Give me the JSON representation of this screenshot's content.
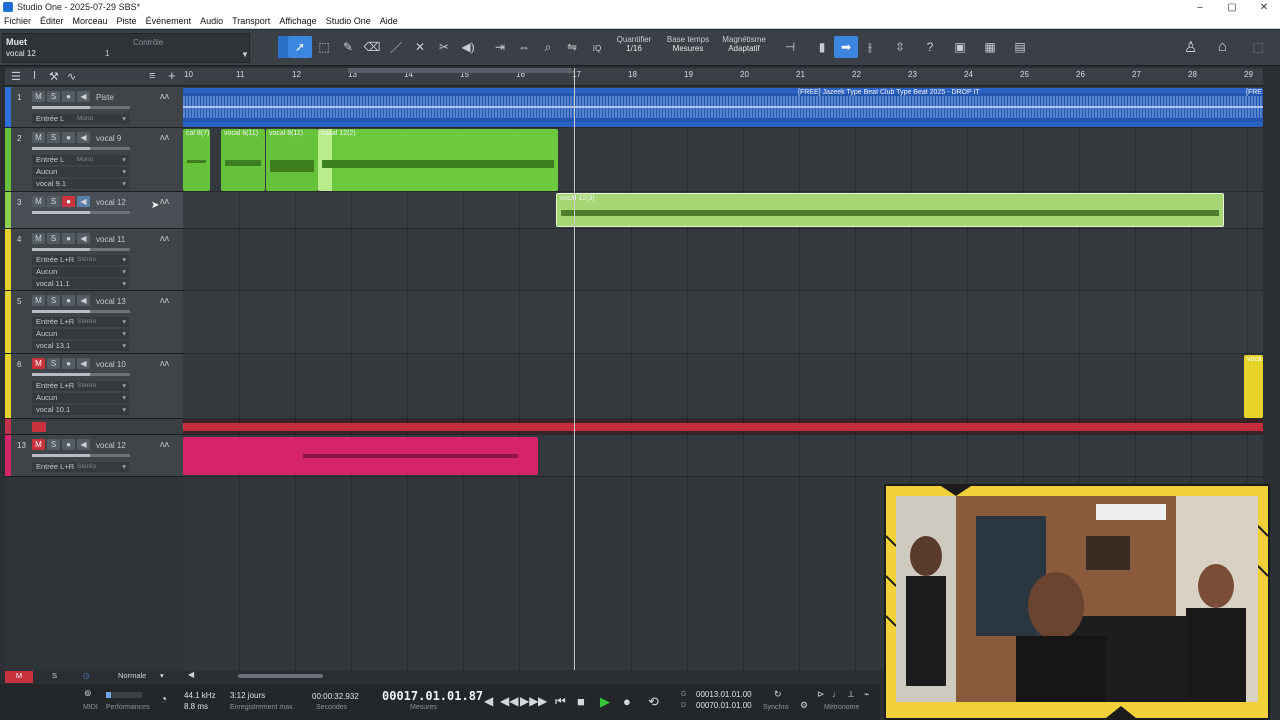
{
  "window": {
    "title": "Studio One - 2025-07-29 SBS*",
    "controls": [
      "–",
      "▢",
      "✕"
    ]
  },
  "menu": [
    "Fichier",
    "Éditer",
    "Morceau",
    "Piste",
    "Événement",
    "Audio",
    "Transport",
    "Affichage",
    "Studio One",
    "Aide"
  ],
  "inspector": {
    "mode": "Muet",
    "controle_label": "Contrôle",
    "track_name": "vocal 12",
    "value": "1"
  },
  "toolbar": {
    "quantize_label": "Quantifier",
    "quantize_value": "1/16",
    "timebase_label": "Base temps",
    "timebase_value": "Mesures",
    "snap_label": "Magnétisme",
    "snap_value": "Adaptatif",
    "iq_label": "IQ"
  },
  "ruler": {
    "bars": [
      "10",
      "11",
      "12",
      "13",
      "14",
      "15",
      "16",
      "17",
      "18",
      "19",
      "20",
      "21",
      "22",
      "23",
      "24",
      "25",
      "26",
      "27",
      "28",
      "29"
    ]
  },
  "tracks": [
    {
      "num": "1",
      "name": "Piste",
      "input": "Entrée L",
      "input_tag": "Mono",
      "color": "#2f6fd8",
      "mute": false,
      "rec": false,
      "rows": []
    },
    {
      "num": "2",
      "name": "vocal 9",
      "input": "Entrée L",
      "input_tag": "Mono",
      "color": "#66c23a",
      "mute": false,
      "rec": false,
      "rows": [
        "Aucun",
        "vocal 9.1"
      ]
    },
    {
      "num": "3",
      "name": "vocal 12",
      "input": "",
      "input_tag": "",
      "color": "#8ed04b",
      "mute": false,
      "rec": true,
      "rows": []
    },
    {
      "num": "4",
      "name": "vocal 11",
      "input": "Entrée L+R",
      "input_tag": "Stéréo",
      "color": "#e6d32a",
      "mute": false,
      "rec": false,
      "rows": [
        "Aucun",
        "vocal 11.1"
      ]
    },
    {
      "num": "5",
      "name": "vocal 13",
      "input": "Entrée L+R",
      "input_tag": "Stéréo",
      "color": "#e6d32a",
      "mute": false,
      "rec": false,
      "rows": [
        "Aucun",
        "vocal 13.1"
      ]
    },
    {
      "num": "6",
      "name": "vocal 10",
      "input": "Entrée L+R",
      "input_tag": "Stéréo",
      "color": "#e6d32a",
      "mute": true,
      "rec": false,
      "rows": [
        "Aucun",
        "vocal 10.1"
      ]
    },
    {
      "num": "13",
      "name": "vocal 12",
      "input": "Entrée L+R",
      "input_tag": "Stéréo",
      "color": "#d6246b",
      "mute": true,
      "rec": false,
      "rows": []
    }
  ],
  "events": {
    "beat_title": "[FREE] Jazeek Type Beat  Club Type Beat 2025 - DROP IT",
    "beat_title_2": "[FRE",
    "vocal9_labels": [
      "cal 8(7)",
      "vocal 8(11)",
      "vocal 8(11)",
      "vocal 12(2)"
    ],
    "vocal12_label": "vocal 12(3)",
    "vocal10_label": "voca"
  },
  "bottom_left": {
    "m": "M",
    "s": "S",
    "mode": "Normale"
  },
  "transport": {
    "midi": "MIDI",
    "performance": "Performances",
    "sample_rate": "44.1 kHz",
    "latency": "8.8 ms",
    "rec_max": "3:12 jours",
    "rec_max_label": "Enregistrement max.",
    "seconds": "00:00:32.932",
    "seconds_label": "Secondes",
    "position": "00017.01.01.87",
    "position_label": "Mesures",
    "loop_start": "00013.01.01.00",
    "loop_end": "00070.01.01.00",
    "loop_start_tag": "G",
    "loop_end_tag": "D",
    "sync_label": "Synchro",
    "metronome_label": "Métronome"
  },
  "colors": {
    "accent": "#3d86e0",
    "beat_blue": "#2f6fd8",
    "vocal_green": "#66c23a",
    "vocal_light_green": "#9ed36a",
    "vocal_yellow": "#e6d32a",
    "vocal_pink": "#d6246b",
    "mute_red": "#c8323c"
  }
}
